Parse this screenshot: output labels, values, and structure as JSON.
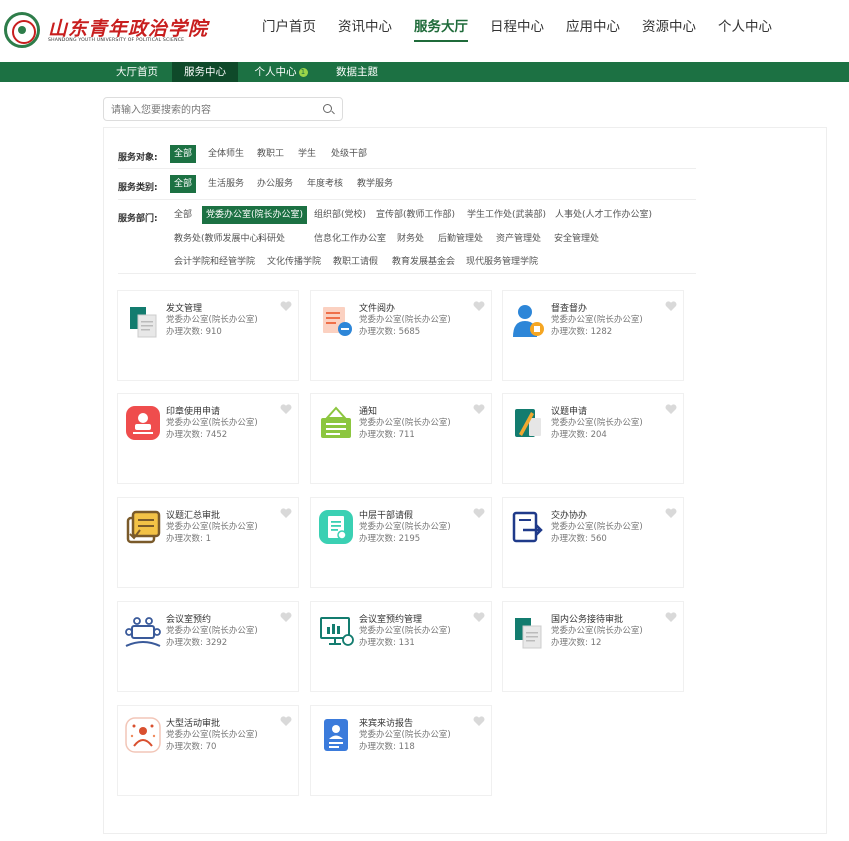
{
  "header": {
    "school_name": "山东青年政治学院",
    "school_name_en": "SHANDONG YOUTH UNIVERSITY OF POLITICAL SCIENCE",
    "nav": [
      "门户首页",
      "资讯中心",
      "服务大厅",
      "日程中心",
      "应用中心",
      "资源中心",
      "个人中心"
    ],
    "nav_active": "服务大厅"
  },
  "subnav": {
    "items": [
      "大厅首页",
      "服务中心",
      "个人中心",
      "数据主题"
    ],
    "active": "服务中心",
    "badge": "1"
  },
  "search": {
    "placeholder": "请输入您要搜索的内容"
  },
  "filters": {
    "target": {
      "label": "服务对象:",
      "options": [
        "全部",
        "全体师生",
        "教职工",
        "学生",
        "处级干部"
      ],
      "selected": "全部"
    },
    "category": {
      "label": "服务类别:",
      "options": [
        "全部",
        "生活服务",
        "办公服务",
        "年度考核",
        "教学服务"
      ],
      "selected": "全部"
    },
    "department": {
      "label": "服务部门:",
      "row1": [
        "全部",
        "党委办公室(院长办公室)",
        "组织部(党校)",
        "宣传部(教师工作部)",
        "学生工作处(武装部)",
        "人事处(人才工作办公室)"
      ],
      "row2": [
        "教务处(教师发展中心)",
        "科研处",
        "信息化工作办公室",
        "财务处",
        "后勤管理处",
        "资产管理处",
        "安全管理处"
      ],
      "row3": [
        "会计学院和经管学院",
        "文化传播学院",
        "教职工请假",
        "教育发展基金会",
        "现代服务管理学院"
      ],
      "selected": "党委办公室(院长办公室)"
    }
  },
  "count_label": "办理次数:",
  "services": [
    {
      "title": "发文管理",
      "dept": "党委办公室(院长办公室)",
      "count": "910",
      "icon": "document-stack-icon"
    },
    {
      "title": "文件阅办",
      "dept": "党委办公室(院长办公室)",
      "count": "5685",
      "icon": "file-read-icon"
    },
    {
      "title": "督查督办",
      "dept": "党委办公室(院长办公室)",
      "count": "1282",
      "icon": "supervisor-icon"
    },
    {
      "title": "印章使用申请",
      "dept": "党委办公室(院长办公室)",
      "count": "7452",
      "icon": "seal-icon"
    },
    {
      "title": "通知",
      "dept": "党委办公室(院长办公室)",
      "count": "711",
      "icon": "notice-icon"
    },
    {
      "title": "议题申请",
      "dept": "党委办公室(院长办公室)",
      "count": "204",
      "icon": "topic-apply-icon"
    },
    {
      "title": "议题汇总审批",
      "dept": "党委办公室(院长办公室)",
      "count": "1",
      "icon": "topic-summary-icon"
    },
    {
      "title": "中层干部请假",
      "dept": "党委办公室(院长办公室)",
      "count": "2195",
      "icon": "leave-request-icon"
    },
    {
      "title": "交办协办",
      "dept": "党委办公室(院长办公室)",
      "count": "560",
      "icon": "assign-icon"
    },
    {
      "title": "会议室预约",
      "dept": "党委办公室(院长办公室)",
      "count": "3292",
      "icon": "meeting-room-icon"
    },
    {
      "title": "会议室预约管理",
      "dept": "党委办公室(院长办公室)",
      "count": "131",
      "icon": "meeting-manage-icon"
    },
    {
      "title": "国内公务接待审批",
      "dept": "党委办公室(院长办公室)",
      "count": "12",
      "icon": "reception-icon"
    },
    {
      "title": "大型活动审批",
      "dept": "党委办公室(院长办公室)",
      "count": "70",
      "icon": "event-icon"
    },
    {
      "title": "来宾来访报告",
      "dept": "党委办公室(院长办公室)",
      "count": "118",
      "icon": "visitor-icon"
    }
  ],
  "colors": {
    "brand_green": "#1c7143",
    "brand_red": "#c81e1e"
  }
}
